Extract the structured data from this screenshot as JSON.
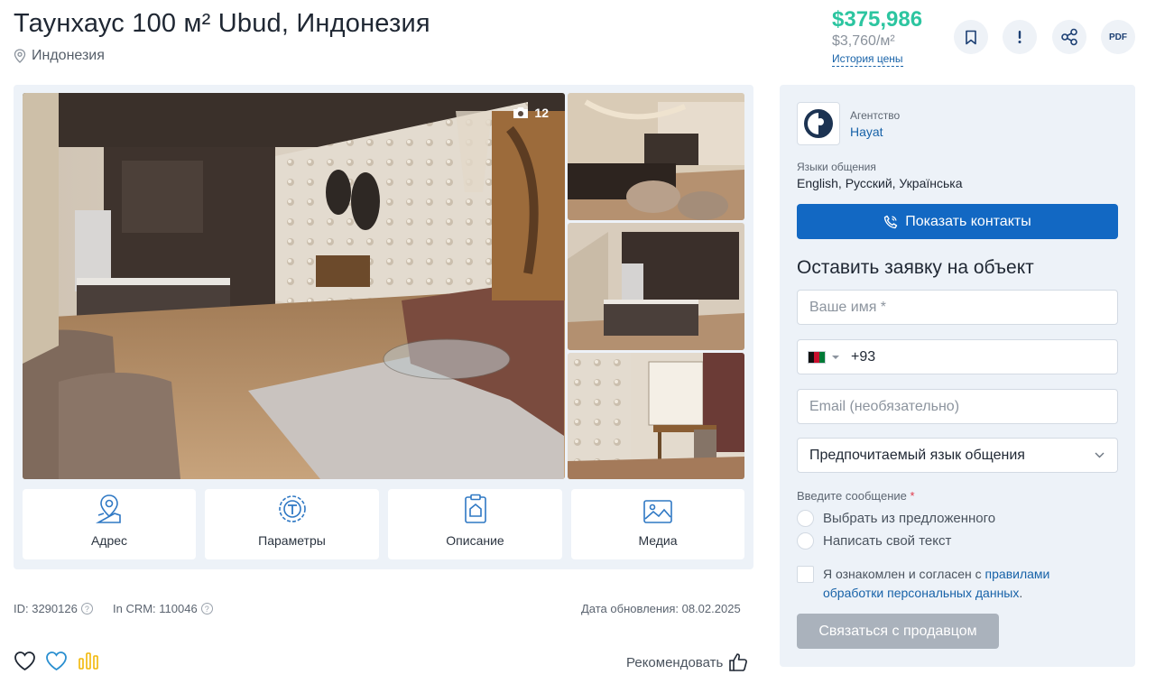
{
  "header": {
    "title": "Таунхаус 100 м² Ubud, Индонезия",
    "location": "Индонезия"
  },
  "price": {
    "total": "$375,986",
    "per_sqm": "$3,760/м²",
    "history_link": "История цены"
  },
  "actions": {
    "pdf_label": "PDF",
    "icons": [
      "bookmark-icon",
      "exclamation-icon",
      "share-icon",
      "pdf-icon"
    ]
  },
  "gallery": {
    "photo_count": "12",
    "tabs": [
      {
        "label": "Адрес",
        "icon": "map-pin-icon"
      },
      {
        "label": "Параметры",
        "icon": "parameters-icon"
      },
      {
        "label": "Описание",
        "icon": "description-icon"
      },
      {
        "label": "Медиа",
        "icon": "media-icon"
      }
    ]
  },
  "meta": {
    "id": "ID: 3290126",
    "crm": "In CRM: 110046",
    "updated": "Дата обновления: 08.02.2025",
    "help_glyph": "?"
  },
  "bottom": {
    "recommend": "Рекомендовать"
  },
  "sidebar": {
    "agency_label": "Агентство",
    "agency_name": "Hayat",
    "languages_label": "Языки общения",
    "languages_value": "English, Русский, Українська",
    "show_contacts": "Показать контакты",
    "form_title": "Оставить заявку на объект",
    "name_placeholder": "Ваше имя *",
    "phone_code": "+93",
    "email_placeholder": "Email (необязательно)",
    "language_select": "Предпочитаемый язык общения",
    "message_label": "Введите сообщение",
    "required_mark": "*",
    "option_choose": "Выбрать из предложенного",
    "option_own": "Написать свой текст",
    "consent_text": "Я ознакомлен и согласен с ",
    "consent_link": "правилами обработки персональных данных",
    "consent_end": ".",
    "contact_seller": "Связаться с продавцом"
  },
  "colors": {
    "price_green": "#2cc5a0",
    "link_blue": "#1762a8",
    "button_blue": "#1268c3",
    "panel_bg": "#edf2f8",
    "disabled_button": "#aab2bc"
  }
}
